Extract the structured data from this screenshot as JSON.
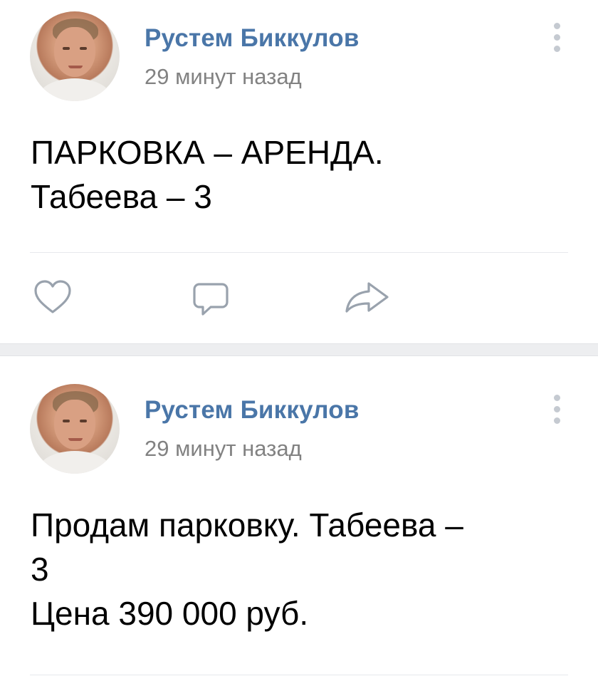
{
  "posts": [
    {
      "author": "Рустем Биккулов",
      "time": "29 минут назад",
      "lines": [
        "ПАРКОВКА – АРЕНДА.",
        "Табеева – 3"
      ],
      "actions": [
        "like",
        "comment",
        "share"
      ]
    },
    {
      "author": "Рустем Биккулов",
      "time": "29 минут назад",
      "lines": [
        "Продам парковку. Табеева –",
        "3",
        "Цена 390 000 руб."
      ]
    }
  ],
  "colors": {
    "author": "#4a76a8",
    "meta": "#828282",
    "icon": "#99a2ad",
    "separator": "#edeef0"
  },
  "icons": [
    "heart-icon",
    "comment-icon",
    "share-icon",
    "more-vertical-icon"
  ]
}
